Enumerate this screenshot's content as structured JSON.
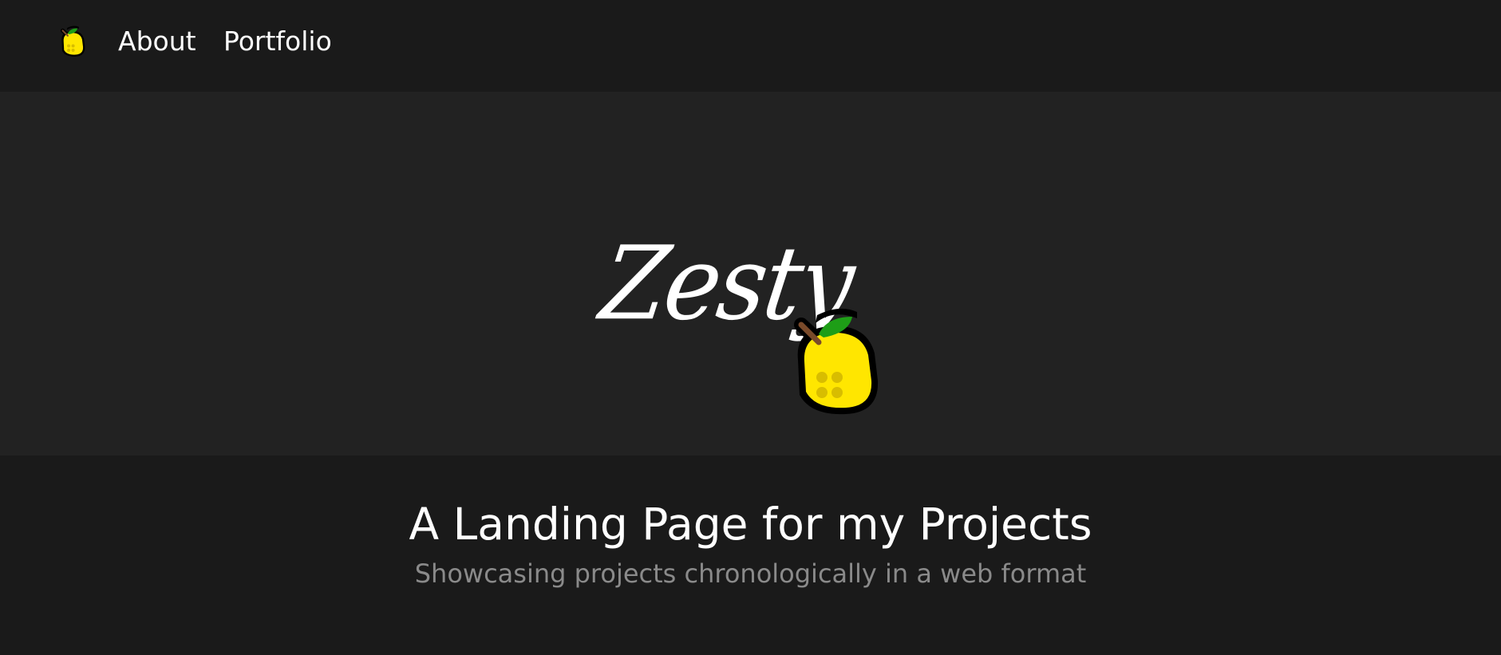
{
  "nav": {
    "logo_icon": "lemon-icon",
    "links": [
      {
        "label": "About"
      },
      {
        "label": "Portfolio"
      }
    ]
  },
  "hero": {
    "title": "Zesty",
    "icon": "lemon-icon"
  },
  "intro": {
    "heading": "A Landing Page for my Projects",
    "subheading": "Showcasing projects chronologically in a web format"
  },
  "colors": {
    "nav_background": "#1a1a1a",
    "hero_background": "#222222",
    "text_primary": "#ffffff",
    "text_muted": "#8a8a8a",
    "lemon_yellow": "#ffe600",
    "leaf_green": "#1e9e17",
    "stem_brown": "#7a4a2a"
  }
}
